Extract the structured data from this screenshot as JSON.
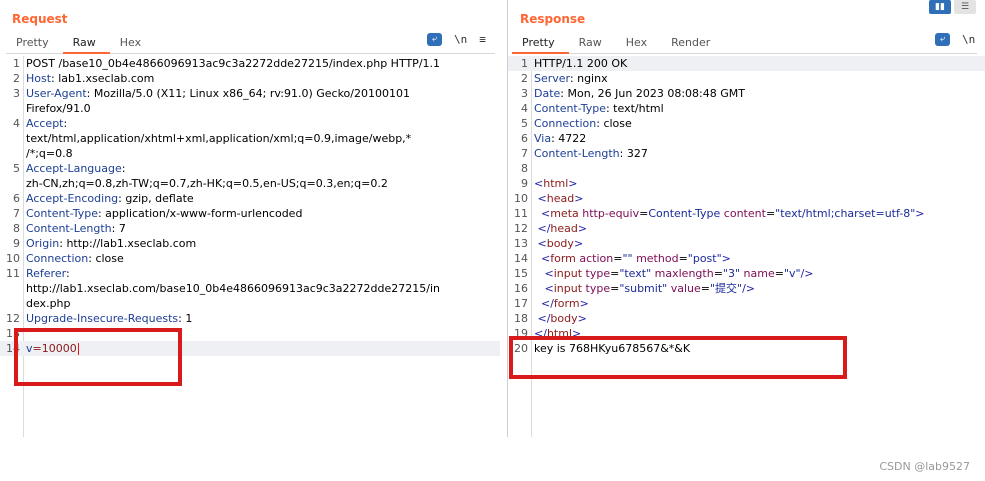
{
  "request": {
    "title": "Request",
    "tabs": [
      "Pretty",
      "Raw",
      "Hex"
    ],
    "active_tab": "Raw",
    "tools": {
      "wrap_icon": "wrap-lines-icon",
      "newline_label": "\\n",
      "menu_icon": "menu-icon"
    },
    "lines": [
      {
        "n": "1",
        "parts": [
          {
            "t": "POST /base10_0b4e4866096913ac9c3a2272dde27215/index.php HTTP/1.1"
          }
        ]
      },
      {
        "n": "2",
        "parts": [
          {
            "t": "Host",
            "c": "hn"
          },
          {
            "t": ": lab1.xseclab.com"
          }
        ]
      },
      {
        "n": "3",
        "parts": [
          {
            "t": "User-Agent",
            "c": "hn"
          },
          {
            "t": ": Mozilla/5.0 (X11; Linux x86_64; rv:91.0) Gecko/20100101"
          }
        ]
      },
      {
        "n": "",
        "parts": [
          {
            "t": "Firefox/91.0"
          }
        ]
      },
      {
        "n": "4",
        "parts": [
          {
            "t": "Accept",
            "c": "hn"
          },
          {
            "t": ":"
          }
        ]
      },
      {
        "n": "",
        "parts": [
          {
            "t": "text/html,application/xhtml+xml,application/xml;q=0.9,image/webp,*"
          }
        ]
      },
      {
        "n": "",
        "parts": [
          {
            "t": "/*;q=0.8"
          }
        ]
      },
      {
        "n": "5",
        "parts": [
          {
            "t": "Accept-Language",
            "c": "hn"
          },
          {
            "t": ":"
          }
        ]
      },
      {
        "n": "",
        "parts": [
          {
            "t": "zh-CN,zh;q=0.8,zh-TW;q=0.7,zh-HK;q=0.5,en-US;q=0.3,en;q=0.2"
          }
        ]
      },
      {
        "n": "6",
        "parts": [
          {
            "t": "Accept-Encoding",
            "c": "hn"
          },
          {
            "t": ": gzip, deflate"
          }
        ]
      },
      {
        "n": "7",
        "parts": [
          {
            "t": "Content-Type",
            "c": "hn"
          },
          {
            "t": ": application/x-www-form-urlencoded"
          }
        ]
      },
      {
        "n": "8",
        "parts": [
          {
            "t": "Content-Length",
            "c": "hn"
          },
          {
            "t": ": 7"
          }
        ]
      },
      {
        "n": "9",
        "parts": [
          {
            "t": "Origin",
            "c": "hn"
          },
          {
            "t": ": http://lab1.xseclab.com"
          }
        ]
      },
      {
        "n": "10",
        "parts": [
          {
            "t": "Connection",
            "c": "hn"
          },
          {
            "t": ": close"
          }
        ]
      },
      {
        "n": "11",
        "parts": [
          {
            "t": "Referer",
            "c": "hn"
          },
          {
            "t": ":"
          }
        ]
      },
      {
        "n": "",
        "parts": [
          {
            "t": "http://lab1.xseclab.com/base10_0b4e4866096913ac9c3a2272dde27215/in"
          }
        ]
      },
      {
        "n": "",
        "parts": [
          {
            "t": "dex.php"
          }
        ]
      },
      {
        "n": "12",
        "parts": [
          {
            "t": "Upgrade-Insecure-Requests",
            "c": "hn"
          },
          {
            "t": ": 1"
          }
        ]
      },
      {
        "n": "13",
        "parts": []
      },
      {
        "n": "14",
        "parts": [
          {
            "t": "v",
            "c": "hn"
          },
          {
            "t": "=10000",
            "c": "tg"
          }
        ],
        "hl": true,
        "caret": true
      }
    ]
  },
  "response": {
    "title": "Response",
    "tabs": [
      "Pretty",
      "Raw",
      "Hex",
      "Render"
    ],
    "active_tab": "Pretty",
    "tools": {
      "wrap_icon": "wrap-lines-icon",
      "newline_label": "\\n"
    },
    "lines": [
      {
        "n": "1",
        "parts": [
          {
            "t": "HTTP/1.1 200 OK"
          }
        ],
        "hl": true
      },
      {
        "n": "2",
        "parts": [
          {
            "t": "Server",
            "c": "hn"
          },
          {
            "t": ": nginx"
          }
        ]
      },
      {
        "n": "3",
        "parts": [
          {
            "t": "Date",
            "c": "hn"
          },
          {
            "t": ": Mon, 26 Jun 2023 08:08:48 GMT"
          }
        ]
      },
      {
        "n": "4",
        "parts": [
          {
            "t": "Content-Type",
            "c": "hn"
          },
          {
            "t": ": text/html"
          }
        ]
      },
      {
        "n": "5",
        "parts": [
          {
            "t": "Connection",
            "c": "hn"
          },
          {
            "t": ": close"
          }
        ]
      },
      {
        "n": "6",
        "parts": [
          {
            "t": "Via",
            "c": "hn"
          },
          {
            "t": ": 4722"
          }
        ]
      },
      {
        "n": "7",
        "parts": [
          {
            "t": "Content-Length",
            "c": "hn"
          },
          {
            "t": ": 327"
          }
        ]
      },
      {
        "n": "8",
        "parts": []
      },
      {
        "n": "9",
        "parts": [
          {
            "t": "<",
            "c": "bracket"
          },
          {
            "t": "html",
            "c": "tg"
          },
          {
            "t": ">",
            "c": "bracket"
          }
        ]
      },
      {
        "n": "10",
        "parts": [
          {
            "t": " <",
            "c": "bracket"
          },
          {
            "t": "head",
            "c": "tg"
          },
          {
            "t": ">",
            "c": "bracket"
          }
        ]
      },
      {
        "n": "11",
        "parts": [
          {
            "t": "  <",
            "c": "bracket"
          },
          {
            "t": "meta",
            "c": "tg"
          },
          {
            "t": " http-equiv",
            "c": "at"
          },
          {
            "t": "="
          },
          {
            "t": "Content-Type",
            "c": "vl"
          },
          {
            "t": " content",
            "c": "at"
          },
          {
            "t": "="
          },
          {
            "t": "\"text/html;charset=utf-8\"",
            "c": "vl"
          },
          {
            "t": ">",
            "c": "bracket"
          }
        ]
      },
      {
        "n": "12",
        "parts": [
          {
            "t": " </",
            "c": "bracket"
          },
          {
            "t": "head",
            "c": "tg"
          },
          {
            "t": ">",
            "c": "bracket"
          }
        ]
      },
      {
        "n": "13",
        "parts": [
          {
            "t": " <",
            "c": "bracket"
          },
          {
            "t": "body",
            "c": "tg"
          },
          {
            "t": ">",
            "c": "bracket"
          }
        ]
      },
      {
        "n": "14",
        "parts": [
          {
            "t": "  <",
            "c": "bracket"
          },
          {
            "t": "form",
            "c": "tg"
          },
          {
            "t": " action",
            "c": "at"
          },
          {
            "t": "="
          },
          {
            "t": "\"\"",
            "c": "vl"
          },
          {
            "t": " method",
            "c": "at"
          },
          {
            "t": "="
          },
          {
            "t": "\"post\"",
            "c": "vl"
          },
          {
            "t": ">",
            "c": "bracket"
          }
        ]
      },
      {
        "n": "15",
        "parts": [
          {
            "t": "   <",
            "c": "bracket"
          },
          {
            "t": "input",
            "c": "tg"
          },
          {
            "t": " type",
            "c": "at"
          },
          {
            "t": "="
          },
          {
            "t": "\"text\"",
            "c": "vl"
          },
          {
            "t": " maxlength",
            "c": "at"
          },
          {
            "t": "="
          },
          {
            "t": "\"3\"",
            "c": "vl"
          },
          {
            "t": " name",
            "c": "at"
          },
          {
            "t": "="
          },
          {
            "t": "\"v\"",
            "c": "vl"
          },
          {
            "t": "/>",
            "c": "bracket"
          }
        ]
      },
      {
        "n": "16",
        "parts": [
          {
            "t": "   <",
            "c": "bracket"
          },
          {
            "t": "input",
            "c": "tg"
          },
          {
            "t": " type",
            "c": "at"
          },
          {
            "t": "="
          },
          {
            "t": "\"submit\"",
            "c": "vl"
          },
          {
            "t": " value",
            "c": "at"
          },
          {
            "t": "="
          },
          {
            "t": "\"提交\"",
            "c": "vl"
          },
          {
            "t": "/>",
            "c": "bracket"
          }
        ]
      },
      {
        "n": "17",
        "parts": [
          {
            "t": "  </",
            "c": "bracket"
          },
          {
            "t": "form",
            "c": "tg"
          },
          {
            "t": ">",
            "c": "bracket"
          }
        ]
      },
      {
        "n": "18",
        "parts": [
          {
            "t": " </",
            "c": "bracket"
          },
          {
            "t": "body",
            "c": "tg"
          },
          {
            "t": ">",
            "c": "bracket"
          }
        ]
      },
      {
        "n": "19",
        "parts": [
          {
            "t": "</",
            "c": "bracket"
          },
          {
            "t": "html",
            "c": "tg"
          },
          {
            "t": ">",
            "c": "bracket"
          }
        ]
      },
      {
        "n": "20",
        "parts": [
          {
            "t": "key is 768HKyu678567&*&K"
          }
        ]
      }
    ]
  },
  "layout_buttons": {
    "split_icon": "split-view-icon",
    "stacked_icon": "stacked-view-icon"
  },
  "watermark": "CSDN @lab9527",
  "colors": {
    "accent": "#ff6633",
    "highlight_box": "#d91a1a",
    "toolbar_button": "#2f6fb8"
  }
}
